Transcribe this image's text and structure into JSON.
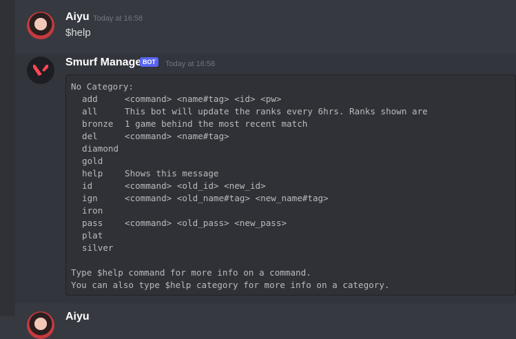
{
  "messages": [
    {
      "author": "Aiyu",
      "timestamp": "Today at 16:58",
      "text": "$help"
    },
    {
      "author": "Smurf Manager",
      "bot_tag": "BOT",
      "timestamp": "Today at 16:58",
      "code": {
        "heading": "No Category:",
        "commands": [
          {
            "name": "add",
            "desc": "<command> <name#tag> <id> <pw>"
          },
          {
            "name": "all",
            "desc": "This bot will update the ranks every 6hrs. Ranks shown are"
          },
          {
            "name": "bronze",
            "desc": "1 game behind the most recent match"
          },
          {
            "name": "del",
            "desc": "<command> <name#tag>"
          },
          {
            "name": "diamond",
            "desc": ""
          },
          {
            "name": "gold",
            "desc": ""
          },
          {
            "name": "help",
            "desc": "Shows this message"
          },
          {
            "name": "id",
            "desc": "<command> <old_id> <new_id>"
          },
          {
            "name": "ign",
            "desc": "<command> <old_name#tag> <new_name#tag>"
          },
          {
            "name": "iron",
            "desc": ""
          },
          {
            "name": "pass",
            "desc": "<command> <old_pass> <new_pass>"
          },
          {
            "name": "plat",
            "desc": ""
          },
          {
            "name": "silver",
            "desc": ""
          }
        ],
        "footer_1": "Type $help command for more info on a command.",
        "footer_2": "You can also type $help category for more info on a category."
      }
    },
    {
      "author": "Aiyu",
      "timestamp": ""
    }
  ],
  "colors": {
    "background": "#36393f",
    "bot_tag": "#5865f2",
    "codeblock": "#2f3136"
  },
  "icons": {
    "bot_avatar": "valorant-logo-icon"
  }
}
